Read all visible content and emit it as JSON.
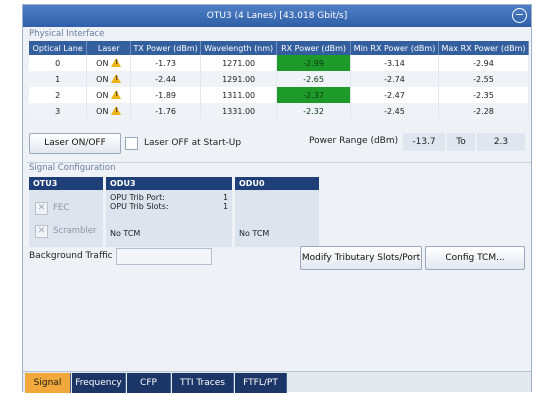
{
  "window": {
    "title": "OTU3 (4 Lanes) [43.018 Gbit/s]"
  },
  "physical_interface": {
    "label": "Physical Interface",
    "columns": [
      "Optical Lane",
      "Laser",
      "TX Power (dBm)",
      "Wavelength (nm)",
      "RX Power (dBm)",
      "Min RX Power (dBm)",
      "Max RX Power (dBm)"
    ],
    "rows": [
      {
        "lane": "0",
        "laser": "ON",
        "tx": "-1.73",
        "wavelength": "1271.00",
        "rx": "-2.99",
        "min_rx": "-3.14",
        "max_rx": "-2.94"
      },
      {
        "lane": "1",
        "laser": "ON",
        "tx": "-2.44",
        "wavelength": "1291.00",
        "rx": "-2.65",
        "min_rx": "-2.74",
        "max_rx": "-2.55"
      },
      {
        "lane": "2",
        "laser": "ON",
        "tx": "-1.89",
        "wavelength": "1311.00",
        "rx": "-2.37",
        "min_rx": "-2.47",
        "max_rx": "-2.35"
      },
      {
        "lane": "3",
        "laser": "ON",
        "tx": "-1.76",
        "wavelength": "1331.00",
        "rx": "-2.32",
        "min_rx": "-2.45",
        "max_rx": "-2.28"
      }
    ],
    "laser_button": "Laser ON/OFF",
    "laser_off_startup": "Laser OFF at Start-Up",
    "power_range_label": "Power Range (dBm)",
    "power_min": "-13.7",
    "power_to": "To",
    "power_max": "2.3"
  },
  "signal_configuration": {
    "label": "Signal Configuration",
    "otu3": {
      "header": "OTU3",
      "fec": "FEC",
      "scrambler": "Scrambler"
    },
    "odu3": {
      "header": "ODU3",
      "trib_port_label": "OPU Trib Port:",
      "trib_port_value": "1",
      "trib_slots_label": "OPU Trib Slots:",
      "trib_slots_value": "1",
      "tcm": "No TCM"
    },
    "odu0": {
      "header": "ODU0",
      "tcm": "No TCM"
    },
    "background_traffic": "Background Traffic",
    "modify_button": "Modify Tributary Slots/Port",
    "config_tcm_button": "Config TCM..."
  },
  "tabs": [
    "Signal",
    "Frequency",
    "CFP",
    "TTI Traces",
    "FTFL/PT"
  ],
  "colors": {
    "title_bar": "#2f5fa8",
    "table_header": "#345f9e",
    "rx_cell": "#1e9a2b",
    "tab_active": "#f2a93c",
    "tab_inactive": "#1b3566"
  }
}
